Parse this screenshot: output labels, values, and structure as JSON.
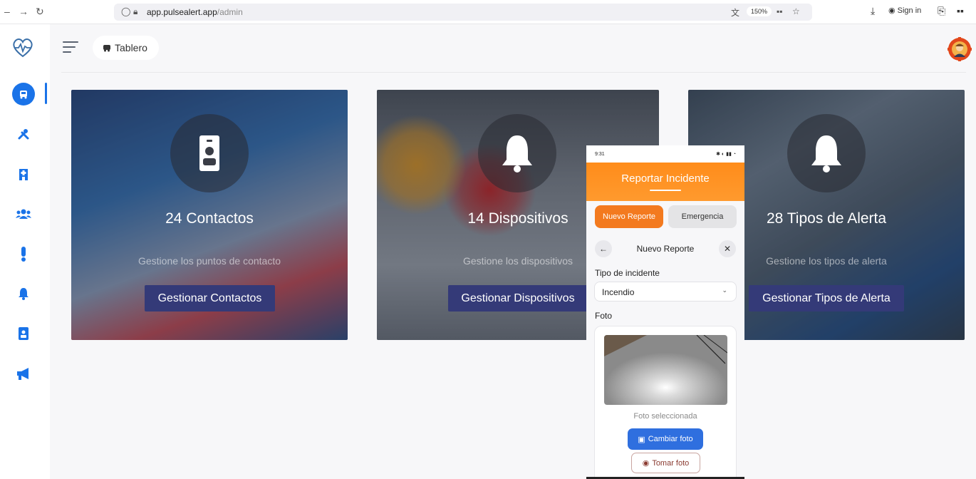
{
  "browser": {
    "url_domain": "app.pulsealert.app",
    "url_path": "/admin",
    "zoom": "150%",
    "signin_label": "Sign in"
  },
  "header": {
    "breadcrumb": "Tablero"
  },
  "cards": [
    {
      "count": "24 Contactos",
      "description": "Gestione los puntos de contacto",
      "button": "Gestionar Contactos",
      "icon": "contact-card-icon"
    },
    {
      "count": "14 Dispositivos",
      "description": "Gestione los dispositivos",
      "button": "Gestionar Dispositivos",
      "icon": "bell-icon"
    },
    {
      "count": "28 Tipos de Alerta",
      "description": "Gestione los tipos de alerta",
      "button": "Gestionar Tipos de Alerta",
      "icon": "bell-icon"
    }
  ],
  "phone": {
    "time": "9:31",
    "title": "Reportar Incidente",
    "tab_new": "Nuevo Reporte",
    "tab_emergency": "Emergencia",
    "subtitle": "Nuevo Reporte",
    "incident_type_label": "Tipo de incidente",
    "incident_type_value": "Incendio",
    "photo_label": "Foto",
    "photo_caption": "Foto seleccionada",
    "change_photo": "Cambiar foto",
    "take_photo": "Tomar foto"
  },
  "colors": {
    "primary": "#1a73e8",
    "card_button": "#343a78",
    "orange": "#ff8c1a"
  }
}
